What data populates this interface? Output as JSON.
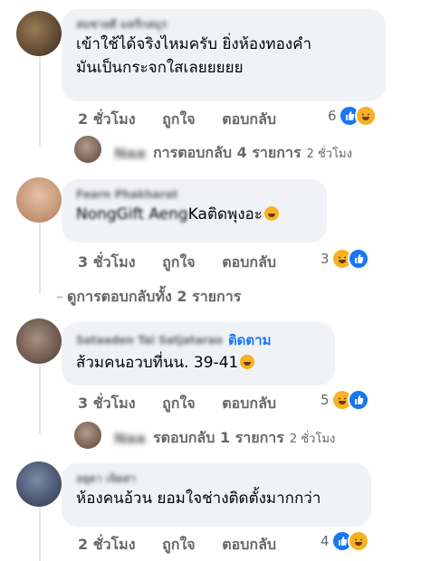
{
  "comments": [
    {
      "author": "สมชายดี มหรืกสมุร",
      "text_line1": "เข้าใช้ได้จริงไหมครับ ยิ่งห้องทองคำ",
      "text_line2": "มันเป็นกระจกใสเลยยยยย",
      "time": "2 ชั่วโมง",
      "like": "ถูกใจ",
      "reply": "ตอบกลับ",
      "reaction_count": "6",
      "reactions": [
        "like-icon",
        "haha-icon"
      ]
    },
    {
      "author": "Fearn Phakharat",
      "text_blurred": "NongGift Aeng",
      "text": "Kaติดพุงอะ",
      "time": "3 ชั่วโมง",
      "like": "ถูกใจ",
      "reply": "ตอบกลับ",
      "reaction_count": "3",
      "reactions": [
        "haha-icon",
        "like-icon"
      ]
    },
    {
      "author": "Sataaden Tai Satjatarao",
      "follow": "ติดตาม",
      "text": "ส้วมคนอวบที่นน. 39-41",
      "time": "3 ชั่วโมง",
      "like": "ถูกใจ",
      "reply": "ตอบกลับ",
      "reaction_count": "5",
      "reactions": [
        "haha-icon",
        "like-icon"
      ]
    },
    {
      "author": "ลยุดา เจิดสา",
      "text": "ห้องคนอ้วน ยอมใจช่างติดตั้งมากกว่า",
      "time": "2 ชั่วโมง",
      "like": "ถูกใจ",
      "reply": "ตอบกลับ",
      "reaction_count": "4",
      "reactions": [
        "like-icon",
        "haha-icon"
      ]
    }
  ],
  "reply_rows": [
    {
      "name": "Naa",
      "label": "การตอบกลับ 4 รายการ",
      "time": "2 ชั่วโมง"
    },
    {
      "name": "Naa",
      "label": "รตอบกลับ 1 รายการ",
      "time": "2 ชั่วโมง"
    }
  ],
  "view_more": "ดูการตอบกลับทั้ง 2 รายการ",
  "colors": {
    "bubble": "#f0f2f5",
    "meta": "#65676b",
    "link": "#1877f2",
    "like": "#1877f2",
    "haha": "#f7b125"
  }
}
